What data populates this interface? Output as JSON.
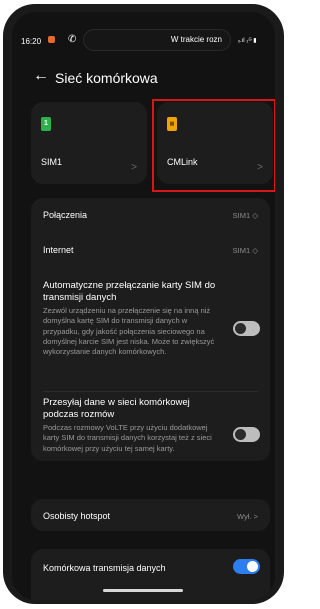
{
  "status_bar": {
    "time": "16:20",
    "call_icon": "phone-icon",
    "pill_text": "W trakcie rozn",
    "signal_text": "ₓ.ıl ₂ᴳ ▮"
  },
  "header": {
    "back_icon": "arrow-left-icon",
    "title": "Sieć komórkowa"
  },
  "sims": [
    {
      "name": "SIM1",
      "icon_text": "1",
      "icon_color": "#2bb24c"
    },
    {
      "name": "CMLink",
      "icon_text": "▦",
      "icon_color": "#f0a30a"
    }
  ],
  "highlight_color": "#d8161b",
  "settings": {
    "calls_label": "Połączenia",
    "calls_value": "SIM1 ◇",
    "internet_label": "Internet",
    "internet_value": "SIM1 ◇",
    "auto_switch_title": "Automatyczne przełączanie karty SIM do transmisji danych",
    "auto_switch_desc": "Zezwól urządzeniu na przełączenie się na inną niż domyślna kartę SIM do transmisji danych w przypadku, gdy jakość połączenia sieciowego na domyślnej karcie SIM jest niska. Może to zwiększyć wykorzystanie danych komórkowych.",
    "volte_title": "Przesyłaj dane w sieci komórkowej podczas rozmów",
    "volte_desc": "Podczas rozmowy VoLTE przy użyciu dodatkowej karty SIM do transmisji danych korzystaj też z sieci komórkowej przy użyciu tej samej karty."
  },
  "hotspot": {
    "label": "Osobisty hotspot",
    "value": "Wył. >"
  },
  "mobile_data": {
    "label": "Komórkowa transmisja danych",
    "enabled": true
  },
  "toggles": {
    "auto_switch": false,
    "volte_data": false
  },
  "accent_color": "#2d7ff0"
}
